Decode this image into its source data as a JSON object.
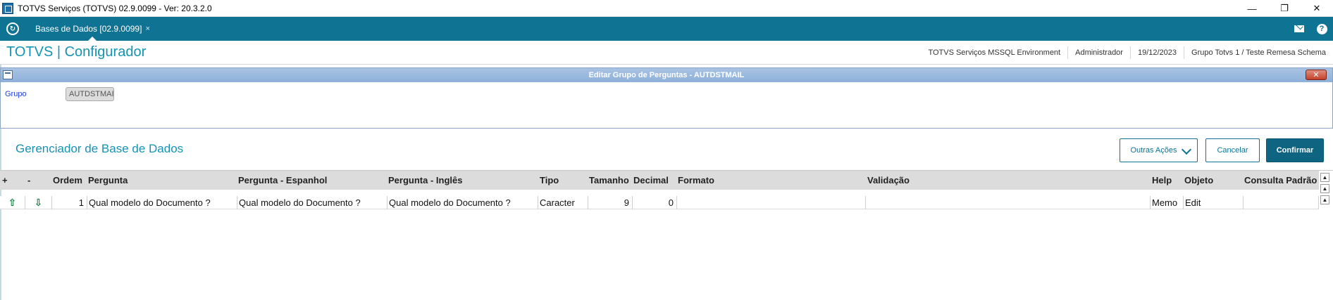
{
  "window": {
    "title": "TOTVS Serviços (TOTVS) 02.9.0099 - Ver: 20.3.2.0",
    "minimize": "—",
    "restore": "❐",
    "close": "✕"
  },
  "tabbar": {
    "home_icon": "↻",
    "tab_label": "Bases de Dados [02.9.0099]",
    "tab_close": "×",
    "help_icon": "?"
  },
  "header": {
    "brand": "TOTVS | Configurador",
    "environment": "TOTVS Serviços MSSQL Environment",
    "user": "Administrador",
    "date": "19/12/2023",
    "company": "Grupo Totvs 1 / Teste Remesa Schema"
  },
  "dialog": {
    "title": "Editar Grupo de Perguntas - AUTDSTMAIL",
    "close_label": "✕",
    "group_label": "Grupo",
    "group_value": "AUTDSTMAIL"
  },
  "section": {
    "title": "Gerenciador de Base de Dados",
    "outras_acoes": "Outras Ações",
    "cancelar": "Cancelar",
    "confirmar": "Confirmar"
  },
  "grid": {
    "columns": [
      "+",
      "-",
      "Ordem",
      "Pergunta",
      "Pergunta - Espanhol",
      "Pergunta - Inglês",
      "Tipo",
      "Tamanho",
      "Decimal",
      "Formato",
      "Validação",
      "Help",
      "Objeto",
      "Consulta Padrão"
    ],
    "rows": [
      {
        "up": "⇧",
        "down": "⇩",
        "ordem": "1",
        "pergunta": "Qual modelo do Documento ?",
        "espanhol": "Qual modelo do Documento ?",
        "ingles": "Qual modelo do Documento ?",
        "tipo": "Caracter",
        "tamanho": "9",
        "decimal": "0",
        "formato": "",
        "validacao": "",
        "help": "Memo",
        "objeto": "Edit",
        "consulta": ""
      }
    ],
    "scroll_top": "▲",
    "scroll_up": "▲"
  },
  "colors": {
    "teal": "#0f7393",
    "brand_text": "#1593b4",
    "confirm_bg": "#0f6482",
    "header_grid": "#dcdcdc"
  }
}
